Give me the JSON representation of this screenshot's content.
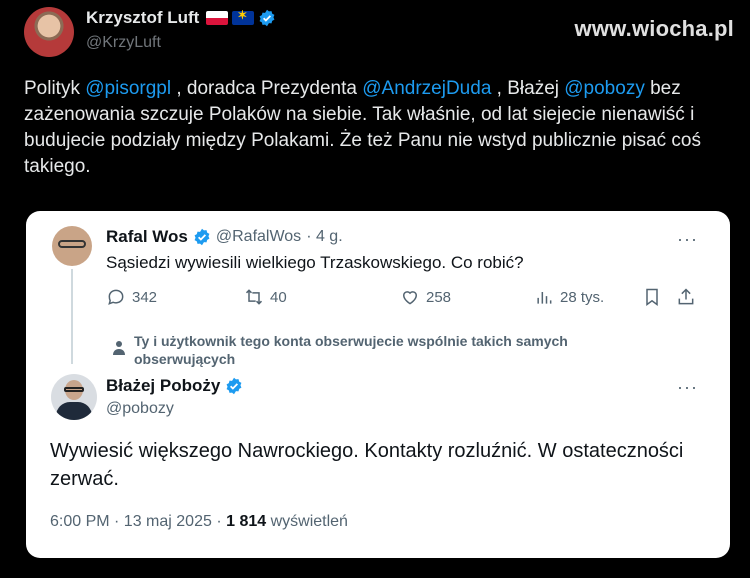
{
  "header": {
    "author_name": "Krzysztof Luft",
    "author_handle": "@KrzyLuft",
    "watermark": "www.wiocha.pl"
  },
  "tweet": {
    "text_1": "Polityk ",
    "mention_1": "@pisorgpl",
    "text_2": " , doradca Prezydenta ",
    "mention_2": "@AndrzejDuda",
    "text_3": " , Błażej ",
    "mention_3": "@pobozy",
    "text_4": " bez zażenowania szczuje Polaków na siebie. Tak właśnie, od lat siejecie nienawiść i budujecie podziały między Polakami. Że też Panu nie wstyd publicznie pisać coś takiego."
  },
  "quoted": {
    "author_name": "Rafal Wos",
    "author_handle": "@RafalWos",
    "time": "· 4 g.",
    "text": "Sąsiedzi wywiesili wielkiego Trzaskowskiego. Co robić?",
    "more": "···",
    "replies": "342",
    "reposts": "40",
    "likes": "258",
    "views": "28 tys."
  },
  "notice": {
    "text": "Ty i użytkownik tego konta obserwujecie wspólnie takich samych obserwujących"
  },
  "reply": {
    "author_name": "Błażej Pobożу",
    "author_handle": "@pobozy",
    "more": "···",
    "text": "Wywiesić większego Nawrockiego. Kontakty rozluźnić. W ostateczności zerwać.",
    "timestamp": "6:00 PM · 13 maj 2025 · ",
    "views_count": "1 814",
    "views_label": " wyświetleń"
  },
  "colors": {
    "accent": "#1d9bf0",
    "background": "#000000",
    "card": "#ffffff",
    "muted": "#536471"
  }
}
